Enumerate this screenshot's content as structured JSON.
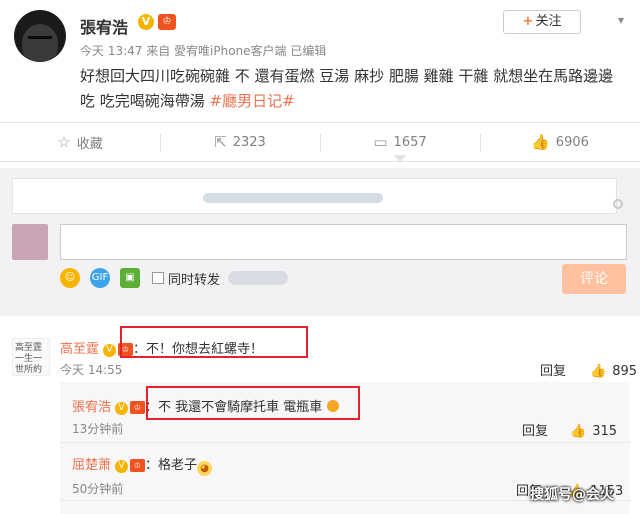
{
  "post": {
    "author": "張宥浩",
    "v_badge": "V",
    "level_badge": "♔",
    "follow_label": "关注",
    "follow_plus": "+",
    "meta": "今天 13:47 来自 愛宥唯iPhone客户端  已编辑",
    "text": "好想回大四川吃碗碗雜 不 還有蛋燃 豆湯 麻抄 肥腸 雞雜 干雜 就想坐在馬路邊邊吃 吃完喝碗海帶湯 ",
    "hashtag": "#廳男日记#"
  },
  "actions": [
    {
      "icon": "☆",
      "label": "收藏"
    },
    {
      "icon": "⇱",
      "label": "2323"
    },
    {
      "icon": "▭",
      "label": "1657"
    },
    {
      "icon": "👍",
      "label": "6906"
    }
  ],
  "comment_box": {
    "sync_label": "同时转发",
    "submit_label": "评论",
    "gif_label": "GIF"
  },
  "comments": [
    {
      "avatar_text": "高至霆一生一世所約",
      "name": "高至霆",
      "text": "：不！你想去紅螺寺！",
      "time": "今天 14:55",
      "reply": "回复",
      "likes": "895"
    }
  ],
  "replies": [
    {
      "name": "張宥浩",
      "text": "：不 我還不會騎摩托車 電瓶車",
      "time": "13分钟前",
      "reply": "回复",
      "likes": "315"
    },
    {
      "name": "屈楚萧",
      "text": "：格老子",
      "time": "50分钟前",
      "reply": "回复",
      "likes": "1153"
    }
  ],
  "watermark": "搜狐号@会火"
}
